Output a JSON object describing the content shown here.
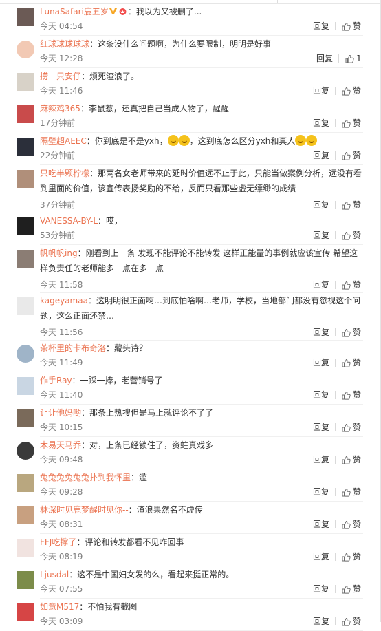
{
  "labels": {
    "reply": "回复",
    "like": "赞"
  },
  "comments": [
    {
      "user": "LunaSafari鹿五岁",
      "badges": true,
      "sep": "：",
      "text": "我以为又被删了...",
      "time": "今天 04:54",
      "likes": "",
      "av": "#6b5a55",
      "round": false
    },
    {
      "user": "红球球球球球",
      "sep": "：",
      "text": "这条没什么问题啊，为什么要限制，明明是好事",
      "time": "今天 12:28",
      "likes": "1",
      "av": "#f2c9b4",
      "round": true
    },
    {
      "user": "捞一只安仔",
      "sep": "：",
      "text": "烦死渣浪了。",
      "time": "今天 11:46",
      "likes": "",
      "av": "#d8d2c8",
      "round": false
    },
    {
      "user": "麻辣鸡365",
      "sep": "：",
      "text": "李鼠惹，还真把自己当成人物了，醒醒",
      "time": "17分钟前",
      "likes": "",
      "av": "#c94b4b",
      "round": false
    },
    {
      "user": "隔壁超AEEC",
      "sep": "：",
      "text": "你到底是不是yxh，",
      "emo1": true,
      "text2": "，这到底怎么区分yxh和真人",
      "emo2": true,
      "time": "22分钟前",
      "likes": "",
      "av": "#2b2f3a",
      "round": false
    },
    {
      "user": "只吃半颗柠檬",
      "sep": "：",
      "text": "那两名女老师带来的延时价值远不止于此，只能当做案例分析，远没有看到里面的价值，该宣传表扬奖励的不给，反而只看那些虚无缥缈的成绩",
      "time": "37分钟前",
      "likes": "",
      "av": "#b08f7a",
      "round": false
    },
    {
      "user": "VANESSA-BY-L",
      "sep": "：",
      "text": "哎，",
      "time": "53分钟前",
      "likes": "",
      "av": "#1f1f1f",
      "round": false
    },
    {
      "user": "帆帆帆ing",
      "sep": "：",
      "text": "刚看到上一条 发现不能评论不能转发  这样正能量的事例就应该宣传 希望这样负责任的老师能多一点在多一点",
      "time": "今天 11:58",
      "likes": "",
      "av": "#8b7d74",
      "round": false
    },
    {
      "user": "kageyamaa",
      "sep": "：",
      "text": "这明明很正面啊…到底怕啥啊…老师，学校，当地部门都没有忽视这个问题，这么正面还禁…",
      "time": "今天 11:56",
      "likes": "",
      "av": "#e9e9e9",
      "round": false
    },
    {
      "user": "茶杯里的卡布奇洛",
      "sep": "：",
      "text": "藏头诗？",
      "time": "今天 11:49",
      "likes": "",
      "av": "#9fb4c8",
      "round": true
    },
    {
      "user": "作手Ray",
      "sep": "：",
      "text": "一踩一捧，老营销号了",
      "time": "今天 11:40",
      "likes": "",
      "av": "#c9d6e3",
      "round": false
    },
    {
      "user": "让让他妈哟",
      "sep": "：",
      "text": "那条上热搜但是马上就评论不了了",
      "time": "今天 10:15",
      "likes": "",
      "av": "#7a6a5a",
      "round": false
    },
    {
      "user": "木易天马乔",
      "sep": "：",
      "text": "对，上条已经锁住了，资蛀真戏多",
      "time": "今天 09:48",
      "likes": "",
      "av": "#3a3a3a",
      "round": true
    },
    {
      "user": "兔兔兔兔兔兔扑到我怀里",
      "sep": "：",
      "text": "滥",
      "time": "今天 09:28",
      "likes": "",
      "av": "#b9a77f",
      "round": false
    },
    {
      "user": "林深时见鹿梦醒时见你--",
      "sep": "：",
      "text": "渣浪果然名不虚传",
      "time": "今天 08:31",
      "likes": "",
      "av": "#c8a080",
      "round": false
    },
    {
      "user": "FFJ吃撑了",
      "sep": "：",
      "text": "评论和转发都看不见咋回事",
      "time": "今天 08:19",
      "likes": "",
      "av": "#f1e3e0",
      "round": false
    },
    {
      "user": "Ljusdal",
      "sep": "：",
      "text": "这不是中国妇女发的么，看起来挺正常的。",
      "time": "今天 07:55",
      "likes": "",
      "av": "#7c8c4a",
      "round": false
    },
    {
      "user": "如意M517",
      "sep": "：",
      "text": "不怕我有截图",
      "time": "今天 03:09",
      "likes": "",
      "av": "#d64545",
      "round": false
    }
  ]
}
